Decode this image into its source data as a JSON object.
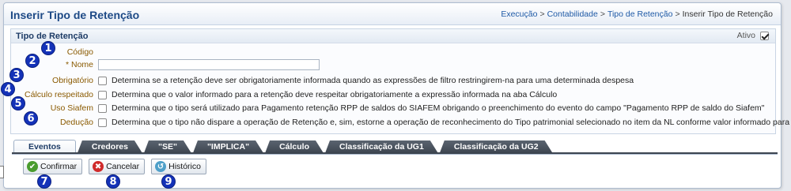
{
  "header": {
    "title": "Inserir Tipo de Retenção",
    "breadcrumb": [
      "Execução",
      "Contabilidade",
      "Tipo de Retenção",
      "Inserir Tipo de Retenção"
    ],
    "sep": ">"
  },
  "panel": {
    "title": "Tipo de Retenção",
    "ativo_label": "Ativo",
    "ativo_checked": true
  },
  "form": {
    "codigo_label": "Código",
    "nome_label": "* Nome",
    "nome_value": "",
    "obrigatorio_label": "Obrigatório",
    "obrigatorio_desc": "Determina se a retenção deve ser obrigatoriamente informada quando as expressões de filtro restringirem-na para uma determinada despesa",
    "calculo_label": "Cálculo respeitado",
    "calculo_desc": "Determina que o valor informado para a retenção deve respeitar obrigatoriamente a expressão informada na aba Cálculo",
    "siafem_label": "Uso Siafem",
    "siafem_desc": "Determina que o tipo será utilizado para Pagamento retenção RPP de saldos do SIAFEM obrigando o preenchimento do evento do campo \"Pagamento RPP de saldo do Siafem\"",
    "deducao_label": "Dedução",
    "deducao_desc": "Determina que o tipo não dispare a operação de Retenção e, sim, estorne a operação de reconhecimento do Tipo patrimonial selecionado no item da NL conforme valor informado para retenção."
  },
  "tabs": [
    "Eventos",
    "Credores",
    "\"SE\"",
    "\"IMPLICA\"",
    "Cálculo",
    "Classificação da UG1",
    "Classificação da UG2"
  ],
  "buttons": {
    "confirmar": "Confirmar",
    "cancelar": "Cancelar",
    "historico": "Histórico"
  },
  "badges": [
    "1",
    "2",
    "3",
    "4",
    "5",
    "6",
    "7",
    "8",
    "9"
  ],
  "icons": {
    "confirmar": "check-icon",
    "cancelar": "cancel-icon",
    "historico": "history-icon"
  }
}
